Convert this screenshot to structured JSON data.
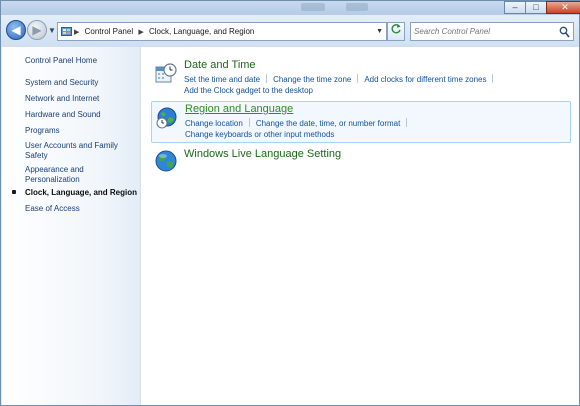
{
  "window": {
    "controls": {
      "minimize": "–",
      "maximize": "□",
      "close": "✕"
    }
  },
  "address_bar": {
    "crumbs": [
      "Control Panel",
      "Clock, Language, and Region"
    ],
    "search_placeholder": "Search Control Panel"
  },
  "sidebar": {
    "items": [
      {
        "label": "Control Panel Home"
      },
      {
        "label": "System and Security"
      },
      {
        "label": "Network and Internet"
      },
      {
        "label": "Hardware and Sound"
      },
      {
        "label": "Programs"
      },
      {
        "label": "User Accounts and Family Safety"
      },
      {
        "label": "Appearance and Personalization"
      },
      {
        "label": "Clock, Language, and Region",
        "active": true
      },
      {
        "label": "Ease of Access"
      }
    ]
  },
  "main": {
    "groups": [
      {
        "title": "Date and Time",
        "icon": "clock-calendar-icon",
        "links_line1": [
          "Set the time and date",
          "Change the time zone",
          "Add clocks for different time zones"
        ],
        "links_line2": [
          "Add the Clock gadget to the desktop"
        ]
      },
      {
        "title": "Region and Language",
        "icon": "globe-clock-icon",
        "links_line1": [
          "Change location",
          "Change the date, time, or number format"
        ],
        "links_line2": [
          "Change keyboards or other input methods"
        ]
      },
      {
        "title": "Windows Live Language Setting",
        "icon": "globe-icon"
      }
    ]
  },
  "colors": {
    "title_green": "#1c6a18",
    "link_blue": "#14509c",
    "highlight_border": "#a9d3f5"
  }
}
